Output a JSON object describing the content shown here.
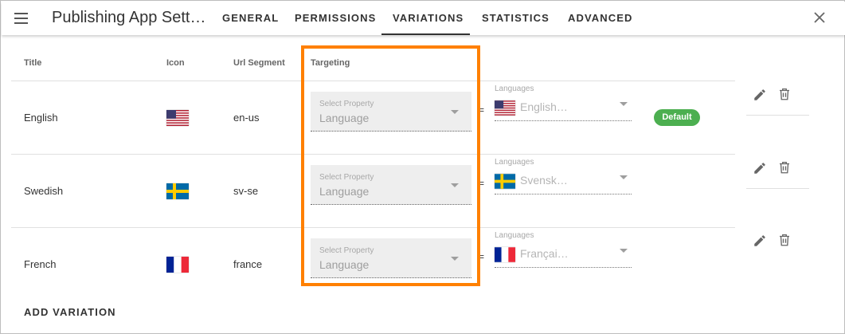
{
  "app": {
    "title": "Publishing App Sett…"
  },
  "tabs": [
    {
      "label": "GENERAL"
    },
    {
      "label": "PERMISSIONS"
    },
    {
      "label": "VARIATIONS"
    },
    {
      "label": "STATISTICS"
    },
    {
      "label": "ADVANCED"
    }
  ],
  "active_tab": "VARIATIONS",
  "icons": {
    "menu": "hamburger-menu-icon",
    "close": "close-icon",
    "edit": "pencil-icon",
    "delete": "trash-icon",
    "dropdown": "caret-down-icon"
  },
  "table": {
    "headers": {
      "title": "Title",
      "icon": "Icon",
      "url_segment": "Url Segment",
      "targeting": "Targeting"
    },
    "rows": [
      {
        "title": "English",
        "flag": "us-flag",
        "url_segment": "en-us",
        "select_label": "Select Property",
        "select_value": "Language",
        "operator": "=",
        "languages_label": "Languages",
        "languages_value": "English…",
        "badge": "Default"
      },
      {
        "title": "Swedish",
        "flag": "sweden-flag",
        "url_segment": "sv-se",
        "select_label": "Select Property",
        "select_value": "Language",
        "operator": "=",
        "languages_label": "Languages",
        "languages_value": "Svensk…"
      },
      {
        "title": "French",
        "flag": "france-flag",
        "url_segment": "france",
        "select_label": "Select Property",
        "select_value": "Language",
        "operator": "=",
        "languages_label": "Languages",
        "languages_value": "Françai…"
      }
    ]
  },
  "add_variation_label": "ADD VARIATION",
  "colors": {
    "highlight": "#ff8000",
    "badge": "#4caf50",
    "select_bg": "#eeeeee"
  }
}
